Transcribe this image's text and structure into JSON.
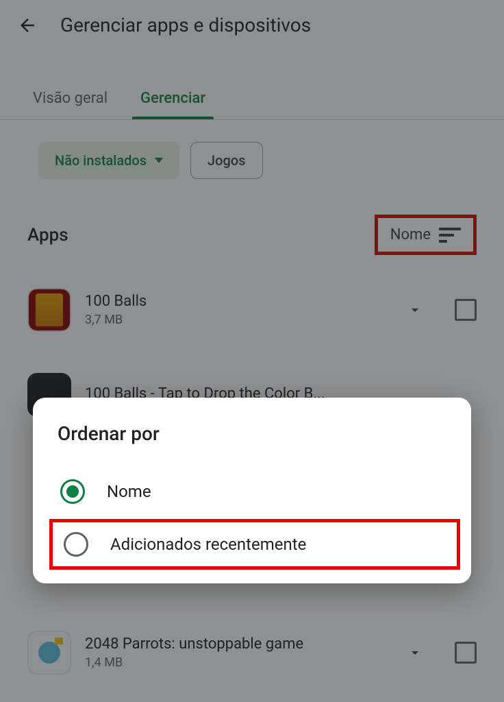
{
  "header": {
    "title": "Gerenciar apps e dispositivos"
  },
  "tabs": {
    "overview": "Visão geral",
    "manage": "Gerenciar"
  },
  "filters": {
    "not_installed": "Não instalados",
    "games": "Jogos"
  },
  "section": {
    "title": "Apps",
    "sort_label": "Nome"
  },
  "apps": [
    {
      "name": "100 Balls",
      "size": "3,7 MB"
    },
    {
      "name": "100 Balls - Tap to Drop the Color B...",
      "size": ""
    },
    {
      "name": "2048 Parrots: unstoppable game",
      "size": "1,4 MB"
    }
  ],
  "dialog": {
    "title": "Ordenar por",
    "options": [
      {
        "label": "Nome",
        "selected": true
      },
      {
        "label": "Adicionados recentemente",
        "selected": false
      }
    ]
  }
}
